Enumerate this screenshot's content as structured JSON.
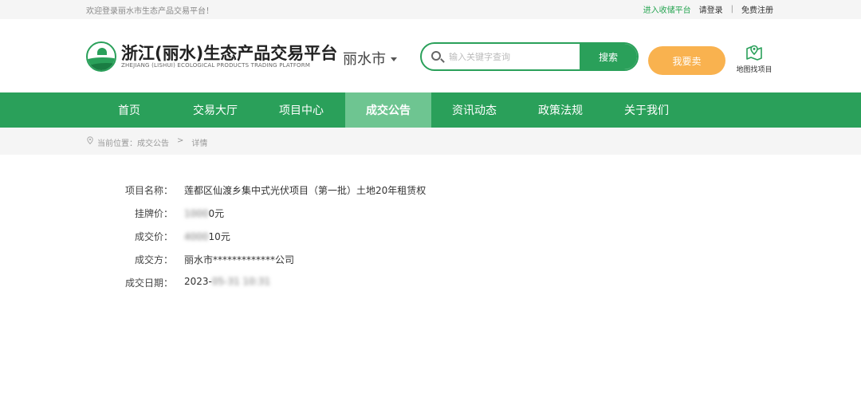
{
  "topbar": {
    "welcome": "欢迎登录丽水市生态产品交易平台！",
    "enter_platform": "进入收储平台",
    "login": "请登录",
    "separator": "|",
    "register": "免费注册"
  },
  "header": {
    "title": "浙江(丽水)生态产品交易平台",
    "subtitle": "ZHEJIANG (LISHUI) ECOLOGICAL PRODUCTS TRADING PLATFORM",
    "city": "丽水市",
    "search_placeholder": "输入关键字查询",
    "search_value": "",
    "search_button": "搜索",
    "sell_button": "我要卖",
    "map_project": "地图找项目"
  },
  "nav": {
    "items": [
      "首页",
      "交易大厅",
      "项目中心",
      "成交公告",
      "资讯动态",
      "政策法规",
      "关于我们"
    ],
    "active": "成交公告"
  },
  "breadcrumb": {
    "prefix": "当前位置：成交公告",
    "arrow": ">",
    "current": "详情"
  },
  "detail": {
    "project_name_label": "项目名称：",
    "project_name_value": "莲都区仙渡乡集中式光伏项目（第一批）土地20年租赁权",
    "listing_price_label": "挂牌价：",
    "listing_price_blur": "1000",
    "listing_price_value": "0元",
    "deal_price_label": "成交价：",
    "deal_price_blur": "4000",
    "deal_price_value": "10元",
    "buyer_label": "成交方：",
    "buyer_value": "丽水市*************公司",
    "date_label": "成交日期：",
    "date_prefix": "2023-",
    "date_blur": "05-31 10:31"
  },
  "colors": {
    "brand_green": "#2aa05a",
    "nav_active": "#6ec591",
    "sell_orange": "#f9b24f"
  }
}
